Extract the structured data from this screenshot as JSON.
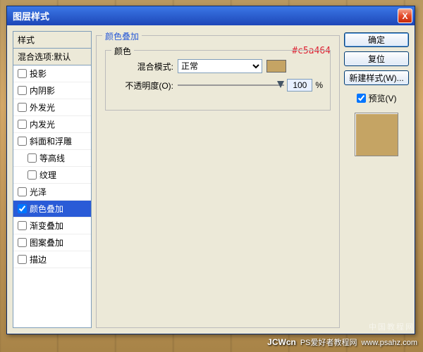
{
  "dialog": {
    "title": "图层样式",
    "close": "X"
  },
  "stylesPanel": {
    "header": "样式",
    "blendOptions": "混合选项:默认",
    "items": [
      {
        "label": "投影",
        "checked": false,
        "indent": false
      },
      {
        "label": "内阴影",
        "checked": false,
        "indent": false
      },
      {
        "label": "外发光",
        "checked": false,
        "indent": false
      },
      {
        "label": "内发光",
        "checked": false,
        "indent": false
      },
      {
        "label": "斜面和浮雕",
        "checked": false,
        "indent": false
      },
      {
        "label": "等高线",
        "checked": false,
        "indent": true
      },
      {
        "label": "纹理",
        "checked": false,
        "indent": true
      },
      {
        "label": "光泽",
        "checked": false,
        "indent": false
      },
      {
        "label": "颜色叠加",
        "checked": true,
        "indent": false,
        "selected": true
      },
      {
        "label": "渐变叠加",
        "checked": false,
        "indent": false
      },
      {
        "label": "图案叠加",
        "checked": false,
        "indent": false
      },
      {
        "label": "描边",
        "checked": false,
        "indent": false
      }
    ]
  },
  "main": {
    "groupTitle": "颜色叠加",
    "innerTitle": "颜色",
    "blendModeLabel": "混合模式:",
    "blendModeValue": "正常",
    "opacityLabel": "不透明度(O):",
    "opacityValue": "100",
    "opacityUnit": "%",
    "colorHex": "#c5a464"
  },
  "right": {
    "ok": "确定",
    "cancel": "复位",
    "newStyle": "新建样式(W)...",
    "previewLabel": "预览(V)",
    "previewChecked": true
  },
  "watermark": {
    "brand": "JCWcn",
    "sub1": "PS爱好者教程网",
    "sub2": "www.psahz.com",
    "faint": "中国教程网"
  }
}
